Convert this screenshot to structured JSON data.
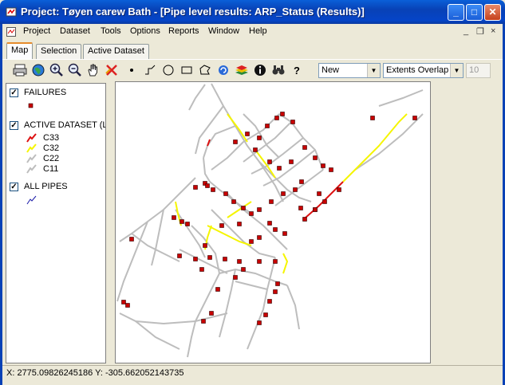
{
  "window": {
    "title": "Project: Tøyen carew Bath - [Pipe level results: ARP_Status (Results)]",
    "min_glyph": "_",
    "max_glyph": "□",
    "close_glyph": "✕"
  },
  "menu": {
    "items": [
      "Project",
      "Dataset",
      "Tools",
      "Options",
      "Reports",
      "Window",
      "Help"
    ],
    "mdi_min": "_",
    "mdi_restore": "❐",
    "mdi_close": "×"
  },
  "tabs": [
    "Map",
    "Selection",
    "Active Dataset"
  ],
  "toolbar": {
    "icons": [
      "printer-icon",
      "globe-icon",
      "zoom-in-icon",
      "zoom-out-icon",
      "pan-hand-icon",
      "clear-selection-icon",
      "select-point-icon",
      "select-line-icon",
      "select-circle-icon",
      "select-rectangle-icon",
      "select-polygon-icon",
      "refresh-icon",
      "layers-icon",
      "info-icon",
      "find-icon",
      "help-icon"
    ],
    "selection_mode": "New",
    "extent_mode": "Extents Overlap",
    "tolerance": "10"
  },
  "legend": {
    "layers": [
      {
        "name": "FAILURES",
        "checked": true,
        "symbols": [
          {
            "type": "square",
            "color": "#c00000",
            "label": ""
          }
        ]
      },
      {
        "name": "ACTIVE DATASET (L",
        "checked": true,
        "symbols": [
          {
            "type": "line",
            "color": "#dd1111",
            "label": "C33"
          },
          {
            "type": "line",
            "color": "#f5f500",
            "label": "C32"
          },
          {
            "type": "line",
            "color": "#bdbdbd",
            "label": "C22"
          },
          {
            "type": "line",
            "color": "#bdbdbd",
            "label": "C11"
          }
        ]
      },
      {
        "name": "ALL PIPES",
        "checked": true,
        "symbols": [
          {
            "type": "line",
            "color": "#1a1aa8",
            "label": ""
          }
        ]
      }
    ],
    "check_glyph": "✓"
  },
  "status": {
    "coordinates": "X: 2775.09826245186 Y: -305.662052143735"
  },
  "colors": {
    "failure": "#c80000",
    "c33": "#dd1111",
    "c32": "#f5f500",
    "pipe": "#bdbdbd"
  }
}
